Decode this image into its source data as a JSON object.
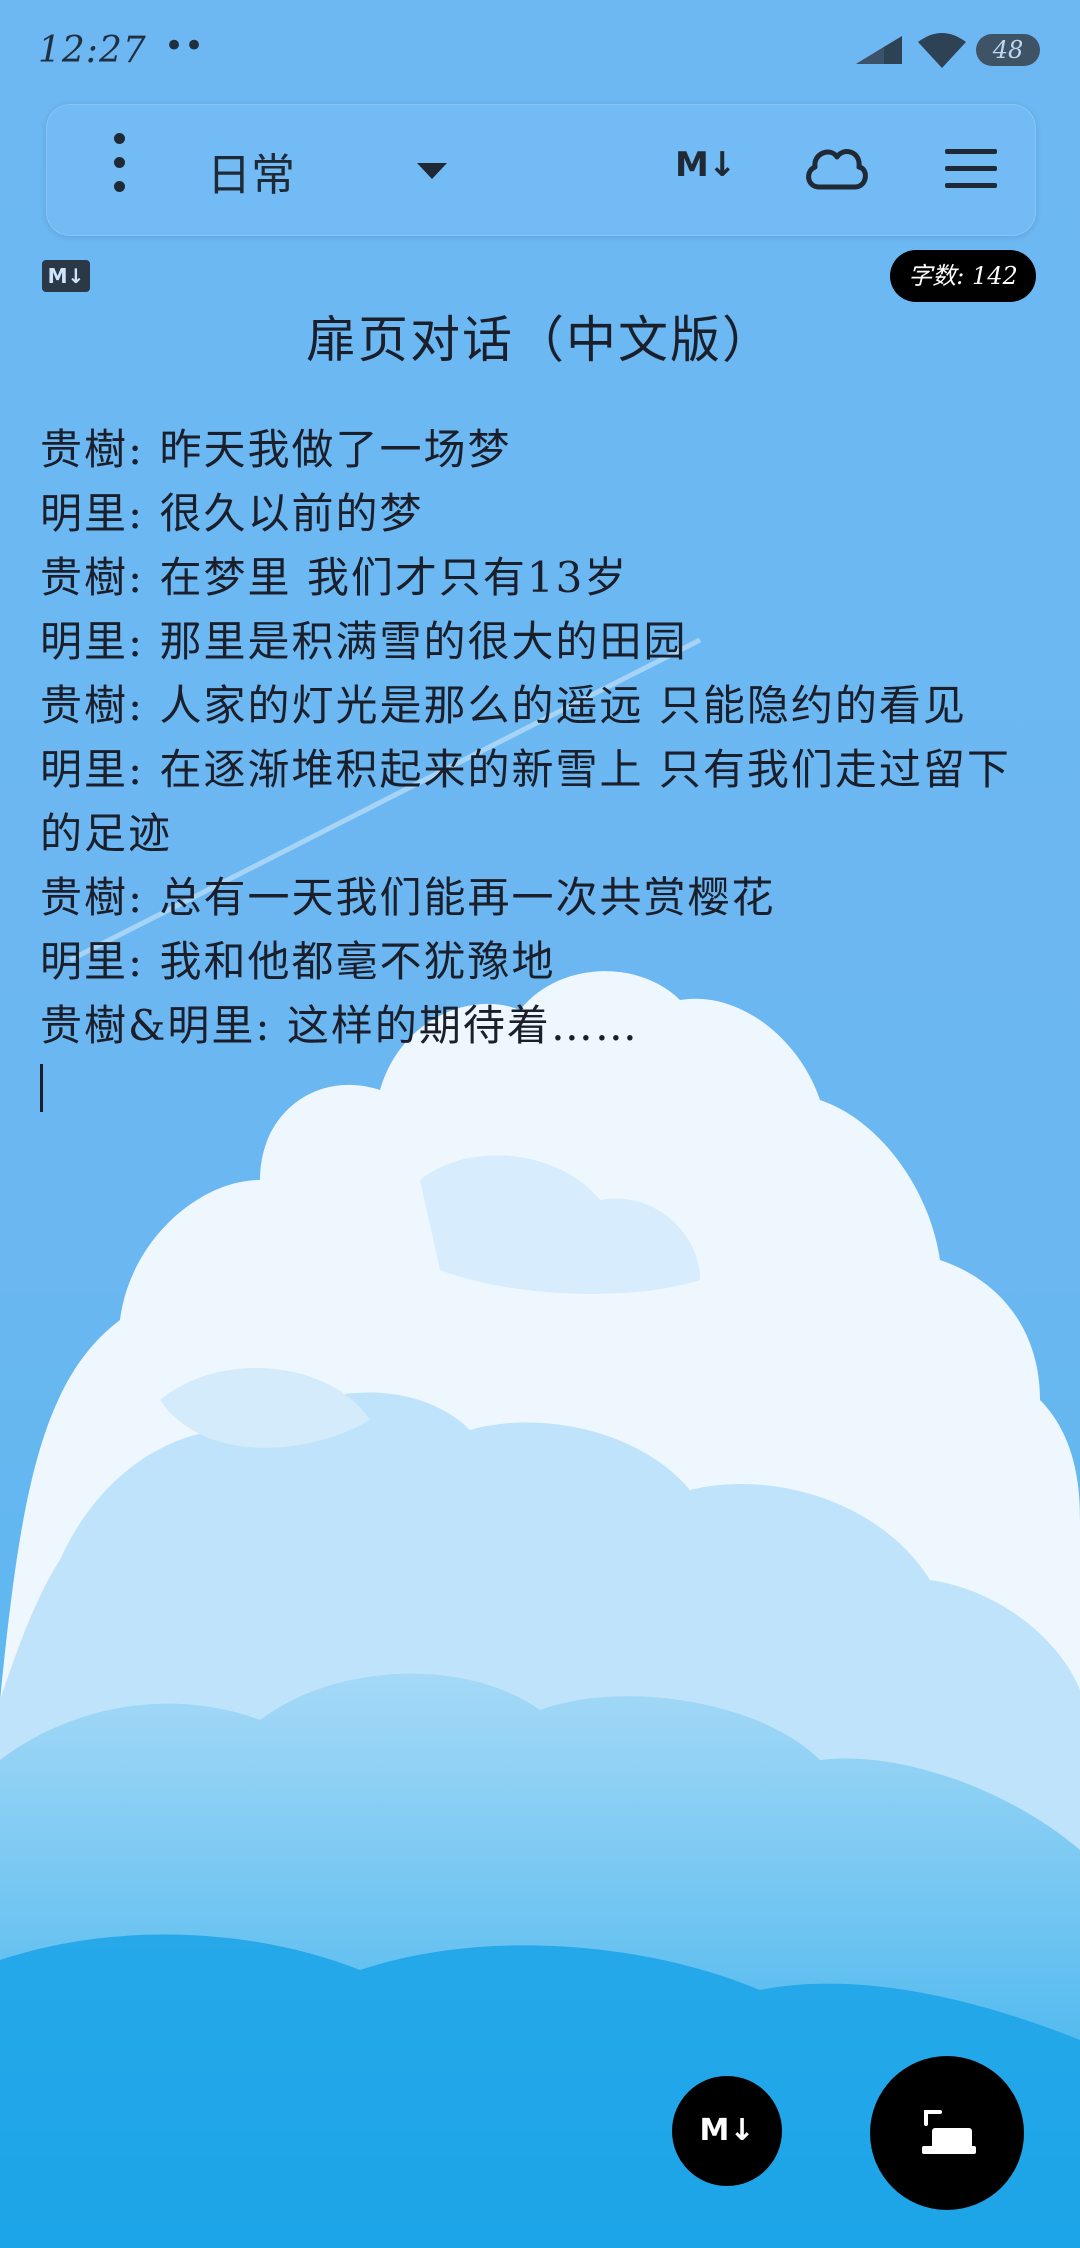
{
  "status_bar": {
    "time": "12:27",
    "notification_dots": "••",
    "battery": "48"
  },
  "toolbar": {
    "notebook_name": "日常",
    "markdown_label": "M↓"
  },
  "document": {
    "markdown_badge": "M↓",
    "word_count": "字数: 142",
    "title": "扉页对话（中文版）",
    "lines": [
      "贵樹: 昨天我做了一场梦",
      "明里: 很久以前的梦",
      "贵樹: 在梦里 我们才只有13岁",
      "明里: 那里是积满雪的很大的田园",
      "贵樹: 人家的灯光是那么的遥远 只能隐约的看见",
      "明里: 在逐渐堆积起来的新雪上 只有我们走过留下的足迹",
      "贵樹: 总有一天我们能再一次共赏樱花",
      "明里: 我和他都毫不犹豫地",
      "贵樹&明里: 这样的期待着……"
    ]
  },
  "fabs": {
    "markdown_label": "M↓"
  },
  "colors": {
    "sky": "#6cb7f2",
    "cloud": "#e6f3fd",
    "cloud_shadow": "#7fcaf4"
  }
}
